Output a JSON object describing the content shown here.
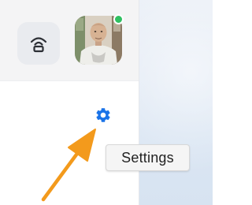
{
  "colors": {
    "accent": "#1a73e8",
    "presence": "#2fc061",
    "annotation_arrow": "#f39a1c"
  },
  "toolbar": {
    "airplay_icon": "airplay-icon",
    "settings_icon": "settings-gear-icon"
  },
  "user": {
    "status": "online"
  },
  "tooltip": {
    "text": "Settings"
  }
}
